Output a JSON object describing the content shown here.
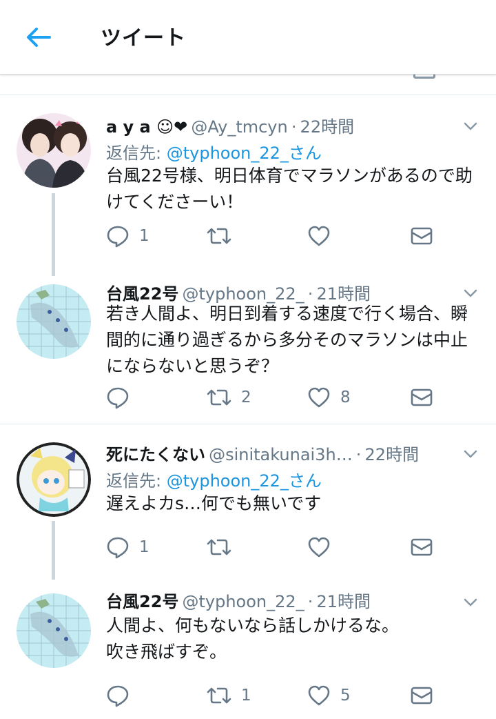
{
  "header": {
    "title": "ツイート"
  },
  "tweets": [
    {
      "display_name": "a y a ☺❤",
      "handle": "@Ay_tmcyn",
      "dot": "·",
      "time": "22時間",
      "reply_label": "返信先: ",
      "reply_handle": "@typhoon_22_さん",
      "text": "台風22号様、明日体育でマラソンがあるので助けてくださーい！",
      "replies": "1",
      "retweets": "",
      "likes": ""
    },
    {
      "display_name": "台風22号",
      "handle": "@typhoon_22_",
      "dot": "·",
      "time": "21時間",
      "text": "若き人間よ、明日到着する速度で行く場合、瞬間的に通り過ぎるから多分そのマラソンは中止にならないと思うぞ？",
      "replies": "",
      "retweets": "2",
      "likes": "8"
    },
    {
      "display_name": "死にたくない",
      "handle": "@sinitakunai3h…",
      "dot": "·",
      "time": "22時間",
      "reply_label": "返信先: ",
      "reply_handle": "@typhoon_22_さん",
      "text": "遅えよカs…何でも無いです",
      "replies": "1",
      "retweets": "",
      "likes": ""
    },
    {
      "display_name": "台風22号",
      "handle": "@typhoon_22_",
      "dot": "·",
      "time": "21時間",
      "text_line1": "人間よ、何もないなら話しかけるな。",
      "text_line2": "吹き飛ばすぞ。",
      "replies": "",
      "retweets": "1",
      "likes": "5"
    }
  ],
  "colors": {
    "accent": "#1da1f2",
    "link": "#1b95e0",
    "secondary_text": "#657786",
    "primary_text": "#14171a",
    "thread_line": "#ccd6dd",
    "divider": "#e1e8ed"
  },
  "icons": {
    "back": "arrow-left-icon",
    "caret": "chevron-down-icon",
    "reply": "reply-bubble-icon",
    "retweet": "retweet-icon",
    "like": "heart-icon",
    "dm": "envelope-icon"
  }
}
